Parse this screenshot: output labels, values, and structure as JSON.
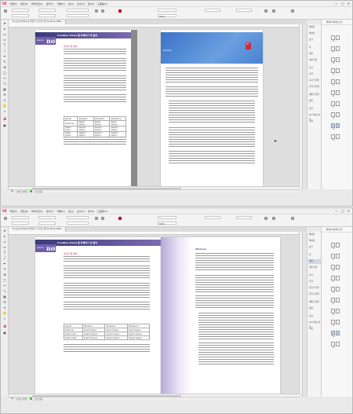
{
  "menubar": {
    "logo": "Id",
    "items": [
      "파일(F)",
      "편집(E)",
      "레이아웃(L)",
      "문자(T)",
      "개체(O)",
      "표(A)",
      "보기(V)",
      "창(W)",
      "도움말(H)"
    ],
    "window_controls": [
      "—",
      "□",
      "✕"
    ]
  },
  "control": {
    "zoom": "100%",
    "fields": [
      "X:",
      "Y:",
      "W:",
      "H:"
    ]
  },
  "tab": {
    "label": "*Id-포토샵 2016 공식적인 스크립트 정리.indd @ 100%"
  },
  "tools": [
    "select-icon",
    "direct-select-icon",
    "page-tool-icon",
    "gap-tool-icon",
    "type-icon",
    "line-icon",
    "pen-icon",
    "pencil-icon",
    "rect-frame-icon",
    "rect-icon",
    "scissors-icon",
    "free-transform-icon",
    "gradient-icon",
    "note-icon",
    "eyedropper-icon",
    "hand-icon",
    "zoom-icon",
    "fill-stroke-icon",
    "mode-icon"
  ],
  "document": {
    "header_title": "Creative Cloud 앱 이해하기 및 알아",
    "badge_prefix": "Lesson",
    "badge_number": "no",
    "section_heading": "어도비 앱 설치",
    "table": [
      [
        "App No.",
        "Windows 7",
        "Windows 8",
        "Windows 10"
      ],
      [
        "Adobe Illu...",
        "Suport Suppor...",
        "Suport Suppor...",
        "Suport Suppor..."
      ],
      [
        "Adobe Indes...",
        "Support Suppor...",
        "Support Suppor...",
        "Support Suppor..."
      ],
      [
        "Adobe Adobe",
        "Support Suppor...",
        "Support Suppor...",
        "Support Suppor..."
      ]
    ],
    "right_heading": "Windows",
    "sign_label": "NO",
    "sky_text": "Creative Cloud 앱을 설치하기\nWindows 운영체제\nMac OS 운영체제"
  },
  "status": {
    "page": "64",
    "profile": "[기본] (작업)",
    "errors": "오류 없음"
  },
  "panel": {
    "items": [
      "페이지",
      "레이어",
      "링크",
      "획",
      "색상",
      "색상 견본",
      "문자",
      "단락",
      "문자 스타일",
      "단락 스타일",
      "개체 스타일",
      "정렬",
      "효과",
      "CC 라이브러리",
      "속성"
    ],
    "selected_index_w2": 4
  },
  "pages_panel": {
    "tabs": "페이지  레이어  링크",
    "page_numbers": [
      "56",
      "57",
      "58",
      "59",
      "60",
      "61",
      "62",
      "63",
      "64",
      "65"
    ]
  }
}
